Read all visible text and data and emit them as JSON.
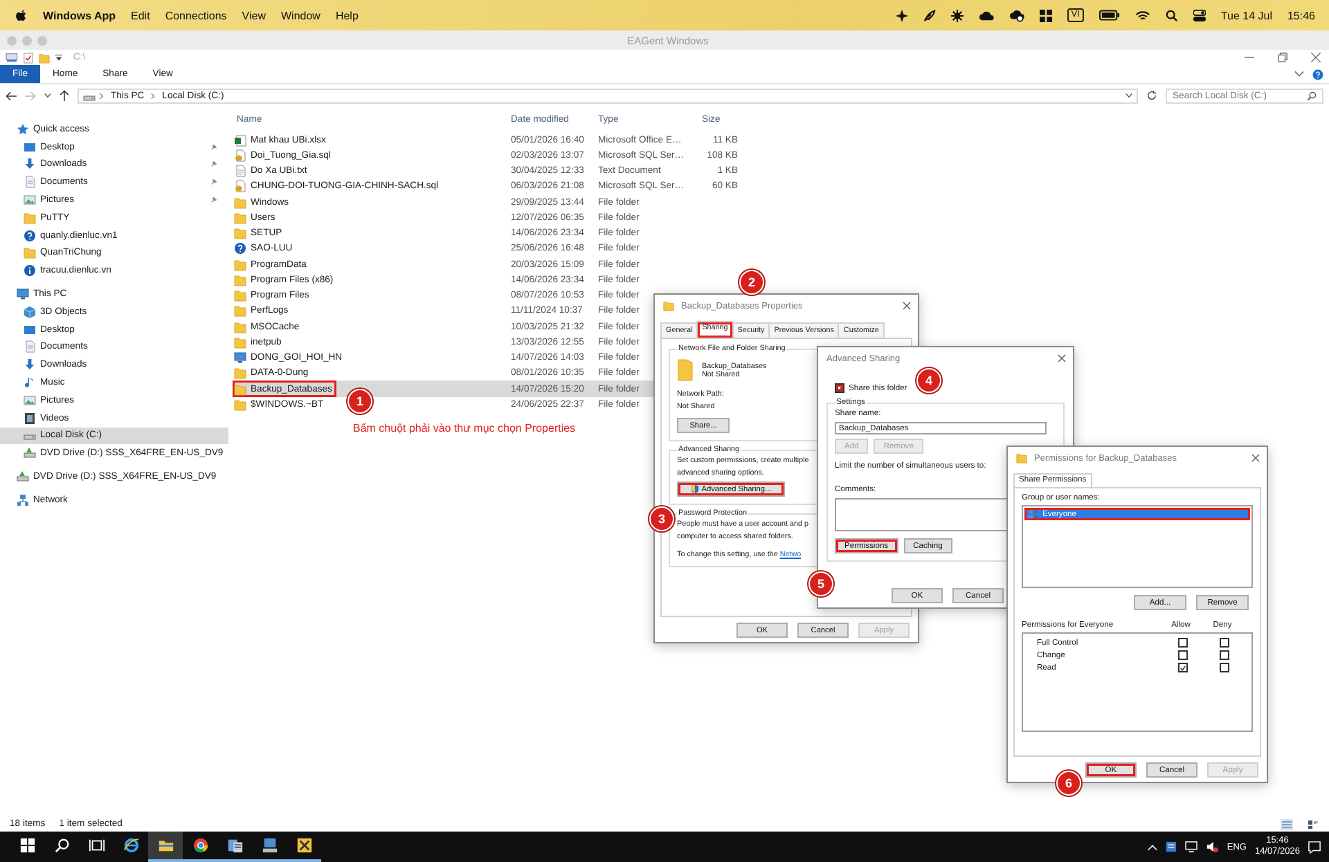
{
  "menubar": {
    "app": "Windows App",
    "items": [
      "Edit",
      "Connections",
      "View",
      "Window",
      "Help"
    ],
    "input_source": "VI",
    "date": "Tue 14 Jul",
    "time": "15:46"
  },
  "window": {
    "title": "EAGent Windows"
  },
  "quick_access_toolbar": {
    "path": "C:\\"
  },
  "ribbon": {
    "tabs": [
      {
        "label": "File",
        "kind": "menu"
      },
      {
        "label": "Home",
        "kind": "tab"
      },
      {
        "label": "Share",
        "kind": "tab"
      },
      {
        "label": "View",
        "kind": "tab"
      }
    ]
  },
  "address_bar": {
    "crumbs": [
      "This PC",
      "Local Disk (C:)"
    ],
    "search_placeholder": "Search Local Disk (C:)"
  },
  "sidebar": {
    "items": [
      {
        "label": "Quick access",
        "kind": "star",
        "selected": false,
        "children": [
          {
            "label": "Desktop",
            "kind": "desktop",
            "selected": false,
            "pinned": true
          },
          {
            "label": "Downloads",
            "kind": "download",
            "selected": false,
            "pinned": true
          },
          {
            "label": "Documents",
            "kind": "document",
            "selected": false,
            "pinned": true
          },
          {
            "label": "Pictures",
            "kind": "picture",
            "selected": false,
            "pinned": true
          },
          {
            "label": "PuTTY",
            "kind": "folder",
            "selected": false,
            "pinned": false
          },
          {
            "label": "quanly.dienluc.vn1",
            "kind": "help",
            "selected": false,
            "pinned": false
          },
          {
            "label": "QuanTriChung",
            "kind": "folder",
            "selected": false,
            "pinned": false
          },
          {
            "label": "tracuu.dienluc.vn",
            "kind": "info",
            "selected": false,
            "pinned": false
          }
        ]
      },
      {
        "label": "This PC",
        "kind": "pc",
        "selected": false,
        "children": [
          {
            "label": "3D Objects",
            "kind": "cube",
            "selected": false
          },
          {
            "label": "Desktop",
            "kind": "desktop",
            "selected": false
          },
          {
            "label": "Documents",
            "kind": "document",
            "selected": false
          },
          {
            "label": "Downloads",
            "kind": "download",
            "selected": false
          },
          {
            "label": "Music",
            "kind": "music",
            "selected": false
          },
          {
            "label": "Pictures",
            "kind": "picture",
            "selected": false
          },
          {
            "label": "Videos",
            "kind": "video",
            "selected": false
          },
          {
            "label": "Local Disk (C:)",
            "kind": "disk",
            "selected": true
          },
          {
            "label": "DVD Drive (D:) SSS_X64FRE_EN-US_DV9",
            "kind": "dvd",
            "selected": false
          }
        ]
      },
      {
        "label": "DVD Drive (D:) SSS_X64FRE_EN-US_DV9",
        "kind": "dvd",
        "selected": false
      },
      {
        "label": "Network",
        "kind": "network",
        "selected": false
      }
    ]
  },
  "file_list": {
    "columns": [
      "Name",
      "Date modified",
      "Type",
      "Size"
    ],
    "rows": [
      {
        "kind": "excel",
        "name": "Mat khau UBi.xlsx",
        "date": "05/01/2026 16:40",
        "type": "Microsoft Office E…",
        "size": "11 KB",
        "selected": false,
        "highlighted": false
      },
      {
        "kind": "sql",
        "name": "Doi_Tuong_Gia.sql",
        "date": "02/03/2026 13:07",
        "type": "Microsoft SQL Ser…",
        "size": "108 KB",
        "selected": false,
        "highlighted": false
      },
      {
        "kind": "text",
        "name": "Do Xa UBi.txt",
        "date": "30/04/2025 12:33",
        "type": "Text Document",
        "size": "1 KB",
        "selected": false,
        "highlighted": false
      },
      {
        "kind": "sql",
        "name": "CHUNG-DOI-TUONG-GIA-CHINH-SACH.sql",
        "date": "06/03/2026 21:08",
        "type": "Microsoft SQL Ser…",
        "size": "60 KB",
        "selected": false,
        "highlighted": false
      },
      {
        "kind": "folder",
        "name": "Windows",
        "date": "29/09/2025 13:44",
        "type": "File folder",
        "selected": false,
        "highlighted": false
      },
      {
        "kind": "folder",
        "name": "Users",
        "date": "12/07/2026 06:35",
        "type": "File folder",
        "selected": false,
        "highlighted": false
      },
      {
        "kind": "folder",
        "name": "SETUP",
        "date": "14/06/2026 23:34",
        "type": "File folder",
        "selected": false,
        "highlighted": false
      },
      {
        "kind": "help",
        "name": "SAO-LUU",
        "date": "25/06/2026 16:48",
        "type": "File folder",
        "selected": false,
        "highlighted": false
      },
      {
        "kind": "folder",
        "name": "ProgramData",
        "date": "20/03/2026 15:09",
        "type": "File folder",
        "selected": false,
        "highlighted": false
      },
      {
        "kind": "folder",
        "name": "Program Files (x86)",
        "date": "14/06/2026 23:34",
        "type": "File folder",
        "selected": false,
        "highlighted": false
      },
      {
        "kind": "folder",
        "name": "Program Files",
        "date": "08/07/2026 10:53",
        "type": "File folder",
        "selected": false,
        "highlighted": false
      },
      {
        "kind": "folder",
        "name": "PerfLogs",
        "date": "11/11/2024 10:37",
        "type": "File folder",
        "selected": false,
        "highlighted": false
      },
      {
        "kind": "folder",
        "name": "MSOCache",
        "date": "10/03/2025 21:32",
        "type": "File folder",
        "selected": false,
        "highlighted": false
      },
      {
        "kind": "folder",
        "name": "inetpub",
        "date": "13/03/2026 12:55",
        "type": "File folder",
        "selected": false,
        "highlighted": false
      },
      {
        "kind": "computer",
        "name": "DONG_GOI_HOI_HN",
        "date": "14/07/2026 14:03",
        "type": "File folder",
        "selected": false,
        "highlighted": false
      },
      {
        "kind": "folder",
        "name": "DATA-0-Dung",
        "date": "08/01/2026 10:35",
        "type": "File folder",
        "selected": false,
        "highlighted": false
      },
      {
        "kind": "folder",
        "name": "Backup_Databases",
        "date": "14/07/2026 15:20",
        "type": "File folder",
        "selected": true,
        "highlighted": true
      },
      {
        "kind": "folder",
        "name": "$WINDOWS.~BT",
        "date": "24/06/2025 22:37",
        "type": "File folder",
        "selected": false,
        "highlighted": false
      }
    ]
  },
  "status_bar": {
    "count": "18 items",
    "selection": "1 item selected"
  },
  "caption": "Bấm chuột phải vào thư mục chọn Properties",
  "properties_dialog": {
    "title": "Backup_Databases Properties",
    "tabs": [
      {
        "label": "General",
        "selected": false,
        "highlighted": false
      },
      {
        "label": "Sharing",
        "selected": true,
        "highlighted": true
      },
      {
        "label": "Security",
        "selected": false,
        "highlighted": false
      },
      {
        "label": "Previous Versions",
        "selected": false,
        "highlighted": false
      },
      {
        "label": "Customize",
        "selected": false,
        "highlighted": false
      }
    ],
    "network_sharing": {
      "heading": "Network File and Folder Sharing",
      "folder": "Backup_Databases",
      "status": "Not Shared",
      "path_label": "Network Path:",
      "path": "Not Shared",
      "button": "Share..."
    },
    "advanced_sharing": {
      "heading": "Advanced Sharing",
      "text_lines": [
        "Set custom permissions, create multiple",
        "advanced sharing options."
      ],
      "button": {
        "label": "Advanced Sharing...",
        "highlighted": true
      }
    },
    "password_protection": {
      "heading": "Password Protection",
      "text_lines": [
        "People must have a user account and p",
        "computer to access shared folders."
      ],
      "setting_text": "To change this setting, use the",
      "link": "Netwo"
    },
    "buttons": [
      {
        "label": "OK",
        "disabled": false,
        "highlighted": false
      },
      {
        "label": "Cancel",
        "disabled": false,
        "highlighted": false
      },
      {
        "label": "Apply",
        "disabled": true,
        "highlighted": false
      }
    ]
  },
  "advanced_sharing_dialog": {
    "title": "Advanced Sharing",
    "share_checkbox": {
      "label": "Share this folder",
      "checked": true,
      "highlighted": true
    },
    "settings": {
      "heading": "Settings",
      "share_name_label": "Share name:",
      "share_name": "Backup_Databases",
      "add_button": {
        "label": "Add",
        "disabled": true,
        "highlighted": false
      },
      "remove_button": {
        "label": "Remove",
        "disabled": true,
        "highlighted": false
      },
      "limit_label": "Limit the number of simultaneous users to:",
      "comments_label": "Comments:",
      "permissions_button": {
        "label": "Permissions",
        "disabled": false,
        "highlighted": true
      },
      "caching_button": {
        "label": "Caching",
        "disabled": false,
        "highlighted": false
      }
    },
    "buttons": [
      {
        "label": "OK",
        "disabled": false,
        "highlighted": false
      },
      {
        "label": "Cancel",
        "disabled": false,
        "highlighted": false
      }
    ]
  },
  "permissions_dialog": {
    "title": "Permissions for Backup_Databases",
    "tabs": [
      {
        "label": "Share Permissions",
        "selected": true
      }
    ],
    "group_label": "Group or user names:",
    "users": [
      {
        "name": "Everyone",
        "selected": true,
        "highlighted": true
      }
    ],
    "add_button": "Add...",
    "remove_button": "Remove",
    "permissions_label": "Permissions for Everyone",
    "allow_label": "Allow",
    "deny_label": "Deny",
    "permissions": [
      {
        "name": "Full Control",
        "allow": false,
        "deny": false
      },
      {
        "name": "Change",
        "allow": false,
        "deny": false
      },
      {
        "name": "Read",
        "allow": true,
        "deny": false
      }
    ],
    "buttons": [
      {
        "label": "OK",
        "disabled": false,
        "highlighted": true
      },
      {
        "label": "Cancel",
        "disabled": false,
        "highlighted": false
      },
      {
        "label": "Apply",
        "disabled": true,
        "highlighted": false
      }
    ]
  },
  "callouts": [
    {
      "label": "1"
    },
    {
      "label": "2"
    },
    {
      "label": "3"
    },
    {
      "label": "4"
    },
    {
      "label": "5"
    },
    {
      "label": "6"
    }
  ],
  "taskbar": {
    "apps": [
      {
        "kind": "start",
        "running": false,
        "selected": false
      },
      {
        "kind": "search",
        "running": false,
        "selected": false
      },
      {
        "kind": "taskview",
        "running": false,
        "selected": false
      },
      {
        "kind": "ie",
        "running": false,
        "selected": false
      },
      {
        "kind": "explorer",
        "running": true,
        "selected": true
      },
      {
        "kind": "chrome",
        "running": true,
        "selected": false
      },
      {
        "kind": "server",
        "running": true,
        "selected": false
      },
      {
        "kind": "computer",
        "running": true,
        "selected": false
      },
      {
        "kind": "tools",
        "running": true,
        "selected": false
      }
    ],
    "language": "ENG",
    "time": "15:46",
    "date": "14/07/2026"
  }
}
